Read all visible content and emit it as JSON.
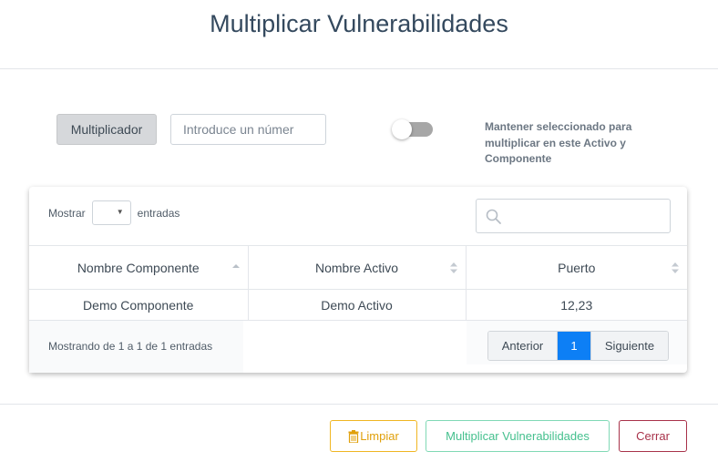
{
  "modal": {
    "title": "Multiplicar Vulnerabilidades"
  },
  "form": {
    "multiplier_label": "Multiplicador",
    "multiplier_placeholder": "Introduce un númer",
    "multiplier_value": "",
    "keep_selected_toggle": false,
    "keep_selected_text": "Mantener seleccionado para multiplicar en este Activo y Componente"
  },
  "table": {
    "show_label": "Mostrar",
    "entries_label": "entradas",
    "page_length": "",
    "search_value": "",
    "columns": [
      "Nombre Componente",
      "Nombre Activo",
      "Puerto"
    ],
    "rows": [
      [
        "Demo Componente",
        "Demo Activo",
        "12,23"
      ]
    ],
    "info": "Mostrando de 1 a 1 de 1 entradas",
    "pagination": {
      "previous": "Anterior",
      "current_page": "1",
      "next": "Siguiente"
    }
  },
  "footer": {
    "clear_label": "Limpiar",
    "multiply_label": "Multiplicar Vulnerabilidades",
    "close_label": "Cerrar"
  },
  "colors": {
    "primary": "#0d7ff5",
    "warning": "#e0a00b",
    "success": "#45c08e",
    "danger": "#a8324a"
  },
  "icons": [
    "search-icon",
    "sort-icon",
    "trash-icon",
    "chevron-down-icon"
  ]
}
